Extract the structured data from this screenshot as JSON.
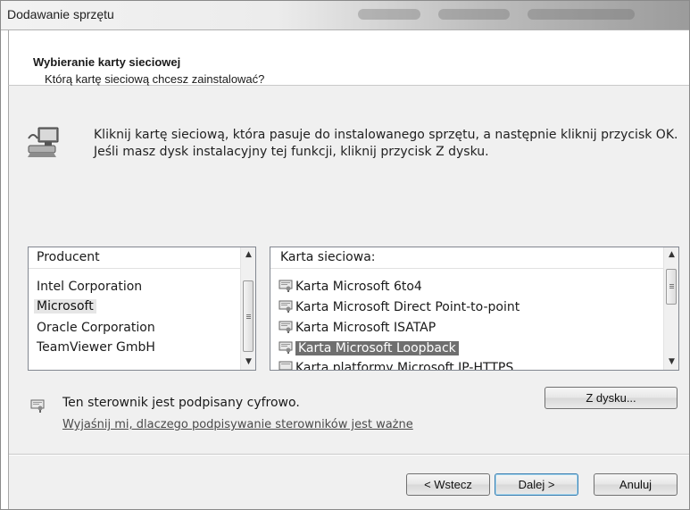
{
  "window": {
    "title": "Dodawanie sprzętu"
  },
  "header": {
    "title": "Wybieranie karty sieciowej",
    "subtitle": "Którą kartę sieciową chcesz zainstalować?"
  },
  "instructions": {
    "line1": "Kliknij kartę sieciową, która pasuje do instalowanego sprzętu, a następnie kliknij przycisk OK.",
    "line2": "Jeśli masz dysk instalacyjny tej funkcji, kliknij przycisk Z dysku."
  },
  "manufacturers": {
    "header": "Producent",
    "items": [
      "Intel Corporation",
      "Microsoft",
      "Oracle Corporation",
      "TeamViewer GmbH"
    ],
    "selected_index": 1
  },
  "adapters": {
    "header": "Karta sieciowa:",
    "items": [
      "Karta Microsoft 6to4",
      "Karta Microsoft Direct Point-to-point",
      "Karta Microsoft ISATAP",
      "Karta Microsoft Loopback",
      "Karta platformy Microsoft IP-HTTPS"
    ],
    "selected_index": 3
  },
  "signature": {
    "text": "Ten sterownik jest podpisany cyfrowo.",
    "link": "Wyjaśnij mi, dlaczego podpisywanie sterowników jest ważne"
  },
  "buttons": {
    "have_disk": "Z dysku...",
    "back": "< Wstecz",
    "next": "Dalej >",
    "cancel": "Anuluj"
  },
  "icons": {
    "wizard": "network-computer-icon",
    "driver": "driver-certificate-icon",
    "signed": "signed-driver-icon"
  }
}
